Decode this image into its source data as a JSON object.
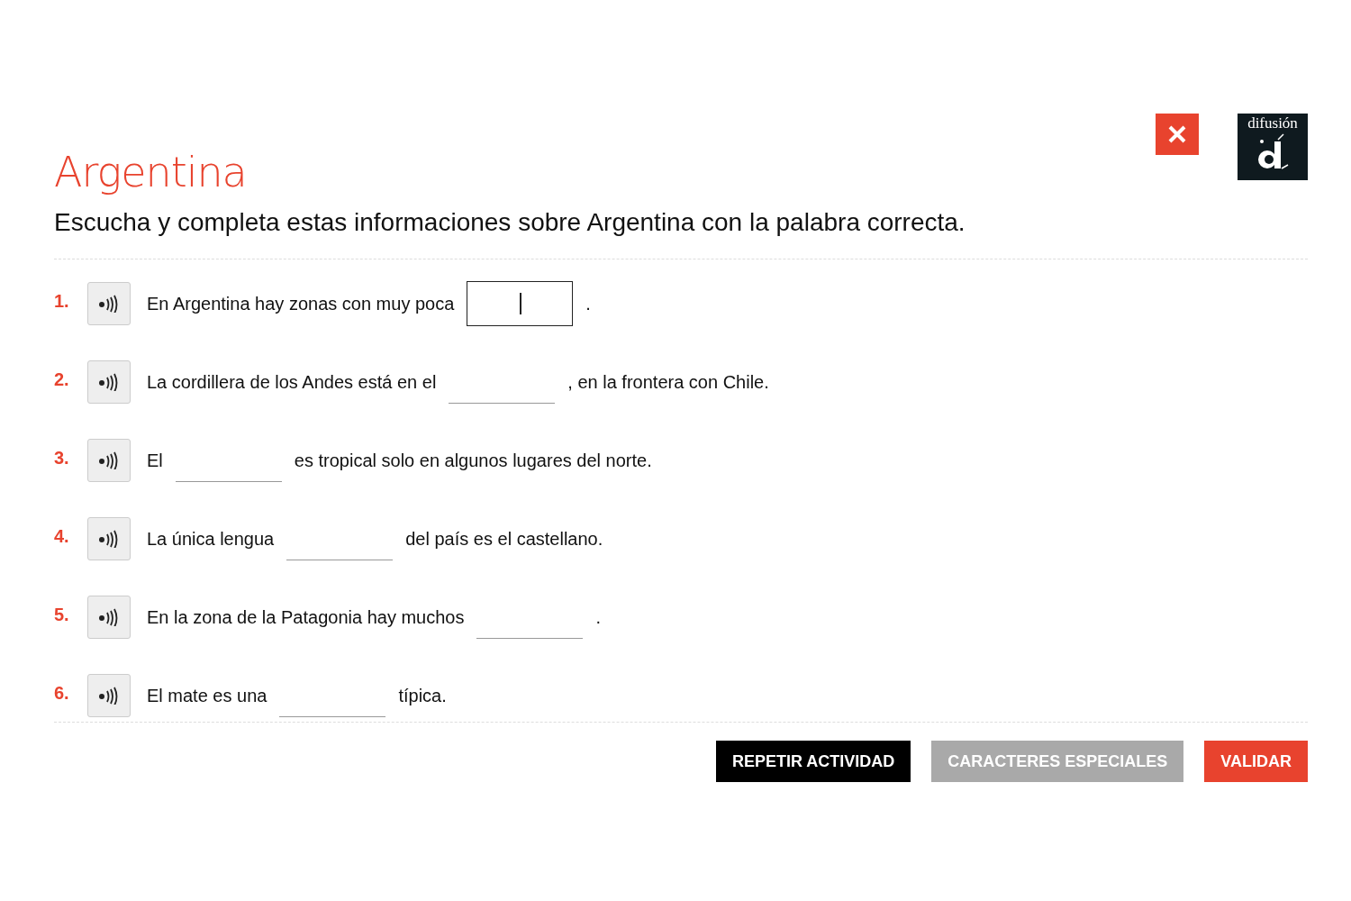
{
  "title": "Argentina",
  "instruction": "Escucha y completa estas informaciones sobre Argentina con la palabra correcta.",
  "logo": {
    "text": "difusión"
  },
  "items": [
    {
      "number": "1.",
      "before": "En Argentina hay zonas con muy poca",
      "after": ".",
      "focused": true
    },
    {
      "number": "2.",
      "before": "La cordillera de los Andes está en el",
      "after": ", en la frontera con Chile.",
      "focused": false
    },
    {
      "number": "3.",
      "before": "El",
      "after": "es tropical solo en algunos lugares del norte.",
      "focused": false
    },
    {
      "number": "4.",
      "before": "La única lengua",
      "after": "del país es el castellano.",
      "focused": false
    },
    {
      "number": "5.",
      "before": "En la zona de la Patagonia hay muchos",
      "after": ".",
      "focused": false
    },
    {
      "number": "6.",
      "before": "El mate es una",
      "after": "típica.",
      "focused": false
    }
  ],
  "buttons": [
    {
      "label": "REPETIR ACTIVIDAD",
      "kind": "dark",
      "disabled": false
    },
    {
      "label": "CARACTERES ESPECIALES",
      "disabled": true
    },
    {
      "label": "VALIDAR",
      "kind": "red",
      "disabled": false
    }
  ]
}
